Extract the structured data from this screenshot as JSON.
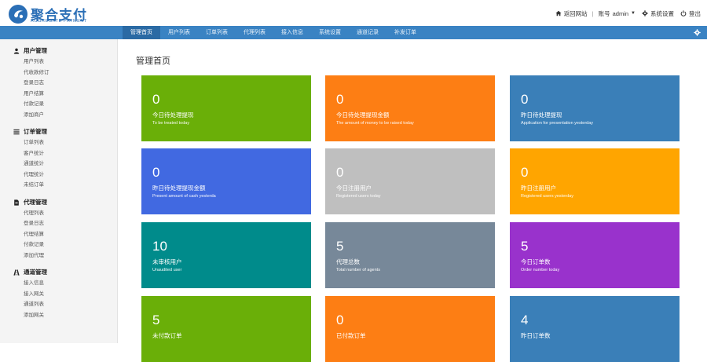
{
  "brand": {
    "name": "聚合支付",
    "subtitle": "AGGREGATE PAYMENT",
    "color": "#2b6fb6"
  },
  "header": {
    "home_link": "返回网站",
    "account_prefix": "账号",
    "account_name": "admin",
    "settings": "系统设置",
    "logout": "登出"
  },
  "nav": {
    "items": [
      "管理首页",
      "用户列表",
      "订单列表",
      "代理列表",
      "接入信息",
      "系统设置",
      "通道记录",
      "补发订单"
    ],
    "active_index": 0,
    "color": "#3a83c3"
  },
  "sidebar": {
    "groups": [
      {
        "title": "用户管理",
        "icon": "user-icon",
        "links": [
          "用户列表",
          "代收款修订",
          "登录日志",
          "用户结算",
          "付款记录",
          "添加商户"
        ]
      },
      {
        "title": "订单管理",
        "icon": "list-icon",
        "links": [
          "订单列表",
          "客户统计",
          "通道统计",
          "代理统计",
          "未结订单"
        ]
      },
      {
        "title": "代理管理",
        "icon": "document-icon",
        "links": [
          "代理列表",
          "登录日志",
          "代理结算",
          "付款记录",
          "添加代理"
        ]
      },
      {
        "title": "通道管理",
        "icon": "road-icon",
        "links": [
          "接入信息",
          "接入网关",
          "通道列表",
          "添加网关"
        ]
      }
    ]
  },
  "main": {
    "title": "管理首页",
    "cards": [
      {
        "value": "0",
        "label": "今日待处理提现",
        "sub": "To be treated today",
        "color": "#6aaf08"
      },
      {
        "value": "0",
        "label": "今日待处理提现金额",
        "sub": "The amount of money to be raised today",
        "color": "#fd7e14"
      },
      {
        "value": "0",
        "label": "昨日待处理提现",
        "sub": "Application for presentation yesterday",
        "color": "#3a7fb8"
      },
      {
        "value": "0",
        "label": "昨日待处理提现金额",
        "sub": "Present amount of cash yesterda",
        "color": "#4169e1"
      },
      {
        "value": "0",
        "label": "今日注册用户",
        "sub": "Registered users today",
        "color": "#bfbfbf"
      },
      {
        "value": "0",
        "label": "昨日注册用户",
        "sub": "Registered users yesterday",
        "color": "#ffa500"
      },
      {
        "value": "10",
        "label": "未审核用户",
        "sub": "Unaudited user",
        "color": "#008b8b"
      },
      {
        "value": "5",
        "label": "代理总数",
        "sub": "Total number of agents",
        "color": "#778899"
      },
      {
        "value": "5",
        "label": "今日订单数",
        "sub": "Order number today",
        "color": "#9932cc"
      },
      {
        "value": "5",
        "label": "未付款订单",
        "sub": "",
        "color": "#6aaf08"
      },
      {
        "value": "0",
        "label": "已付款订单",
        "sub": "",
        "color": "#fd7e14"
      },
      {
        "value": "4",
        "label": "昨日订单数",
        "sub": "",
        "color": "#3a7fb8"
      }
    ]
  }
}
